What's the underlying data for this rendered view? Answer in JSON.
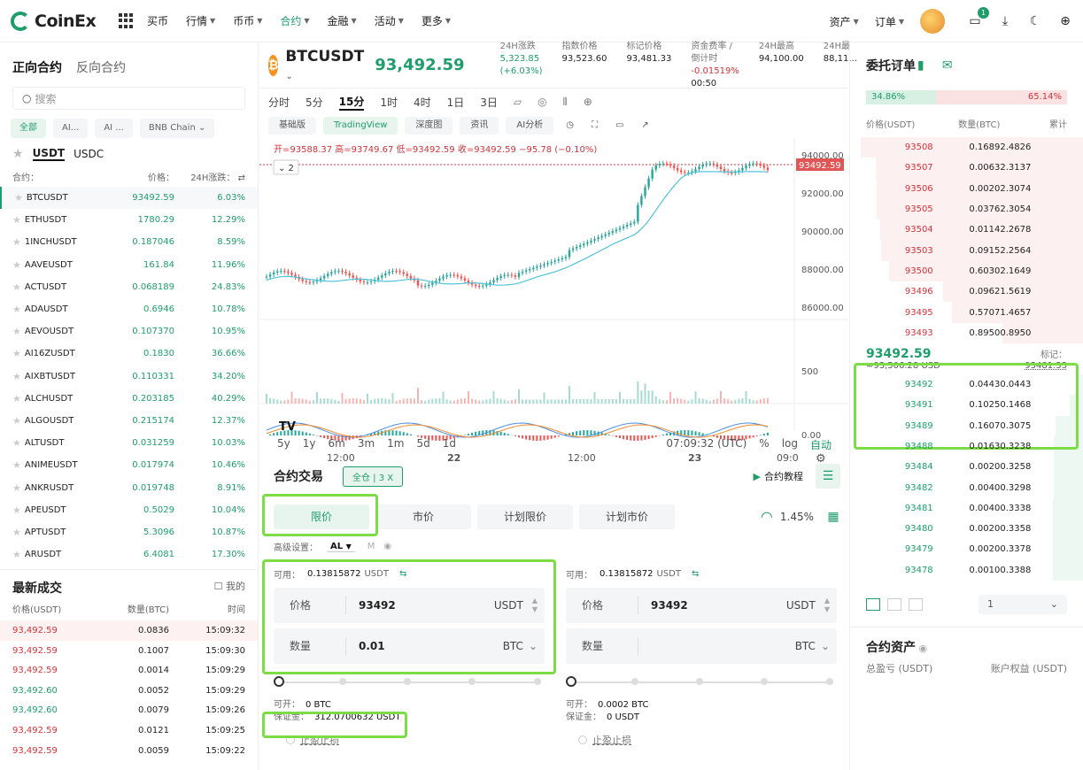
{
  "nav": {
    "brand": "CoinEx",
    "items": [
      "买币",
      "行情",
      "币币",
      "合约",
      "金融",
      "活动",
      "更多"
    ],
    "active": 3,
    "right": [
      "资产",
      "订单"
    ],
    "notif_count": "1"
  },
  "left": {
    "tabs": [
      "正向合约",
      "反向合约"
    ],
    "search_placeholder": "搜索",
    "filters": [
      "全部",
      "AI...",
      "AI ...",
      "BNB Chain"
    ],
    "quotes": [
      "USDT",
      "USDC"
    ],
    "head": {
      "c": "合约：",
      "p": "价格：",
      "ch": "24H涨跌："
    },
    "markets": [
      [
        "BTCUSDT",
        "93492.59",
        "6.03%"
      ],
      [
        "ETHUSDT",
        "1780.29",
        "12.29%"
      ],
      [
        "1INCHUSDT",
        "0.187046",
        "8.59%"
      ],
      [
        "AAVEUSDT",
        "161.84",
        "11.96%"
      ],
      [
        "ACTUSDT",
        "0.068189",
        "24.83%"
      ],
      [
        "ADAUSDT",
        "0.6946",
        "10.78%"
      ],
      [
        "AEVOUSDT",
        "0.107370",
        "10.95%"
      ],
      [
        "AI16ZUSDT",
        "0.1830",
        "36.66%"
      ],
      [
        "AIXBTUSDT",
        "0.110331",
        "34.20%"
      ],
      [
        "ALCHUSDT",
        "0.203185",
        "40.29%"
      ],
      [
        "ALGOUSDT",
        "0.215174",
        "12.37%"
      ],
      [
        "ALTUSDT",
        "0.031259",
        "10.03%"
      ],
      [
        "ANIMEUSDT",
        "0.017974",
        "10.46%"
      ],
      [
        "ANKRUSDT",
        "0.019748",
        "8.91%"
      ],
      [
        "APEUSDT",
        "0.5029",
        "10.04%"
      ],
      [
        "APTUSDT",
        "5.3096",
        "10.87%"
      ],
      [
        "ARUSDT",
        "6.4081",
        "17.30%"
      ]
    ],
    "trades_title": "最新成交",
    "trades_mine": "我的",
    "trades_cols": [
      "价格(USDT)",
      "数量(BTC)",
      "时间"
    ],
    "trades": [
      [
        "93,492.59",
        "0.0836",
        "15:09:32",
        "dn"
      ],
      [
        "93,492.59",
        "0.1007",
        "15:09:30",
        "dn"
      ],
      [
        "93,492.59",
        "0.0014",
        "15:09:29",
        "dn"
      ],
      [
        "93,492.60",
        "0.0052",
        "15:09:29",
        "up"
      ],
      [
        "93,492.60",
        "0.0079",
        "15:09:26",
        "up"
      ],
      [
        "93,492.59",
        "0.0121",
        "15:09:25",
        "dn"
      ],
      [
        "93,492.59",
        "0.0059",
        "15:09:22",
        "dn"
      ]
    ]
  },
  "ticker": {
    "symbol": "BTCUSDT",
    "price": "93,492.59",
    "stats": [
      [
        "24H涨跌",
        "5,323.85 (+6.03%)",
        "up"
      ],
      [
        "指数价格",
        "93,523.60",
        ""
      ],
      [
        "标记价格",
        "93,481.33",
        ""
      ],
      [
        "资金费率 / 倒计时",
        "-0.01519%  00:50",
        "fund"
      ],
      [
        "24H最高",
        "94,100.00",
        ""
      ],
      [
        "24H最",
        "88,11...",
        ""
      ]
    ]
  },
  "chart": {
    "timeframes": [
      "分时",
      "5分",
      "15分",
      "1时",
      "4时",
      "1日",
      "3日"
    ],
    "active_tf": 2,
    "types": [
      "基础版",
      "TradingView",
      "深度图",
      "资讯",
      "AI分析"
    ],
    "active_type": 1,
    "ohlc": "开=93588.37 高=93749.67 低=93492.59 收=93492.59 −95.78 (−0.10%)",
    "indicator_count": "2",
    "price_ticks": [
      "94000.00",
      "92000.00",
      "90000.00",
      "88000.00",
      "86000.00"
    ],
    "last_price": "93492.59",
    "vol_ticks": [
      "500",
      "0.00"
    ],
    "time_ticks": [
      "12:00",
      "22",
      "12:00",
      "23",
      "09:0"
    ],
    "ranges": [
      "5y",
      "1y",
      "6m",
      "3m",
      "1m",
      "5d",
      "1d"
    ],
    "clock": "07:09:32 (UTC)",
    "opts": [
      "%",
      "log",
      "自动"
    ]
  },
  "trade": {
    "title": "合约交易",
    "margin_mode": "全仓 | 3 X",
    "tutorial": "合约教程",
    "order_types": [
      "限价",
      "市价",
      "计划限价",
      "计划市价"
    ],
    "gauge": "1.45%",
    "advanced": "高级设置：",
    "adv_val": "AL",
    "adv_m": "M",
    "buy": {
      "avail_label": "可用：",
      "avail": "0.13815872",
      "avail_unit": "USDT",
      "price_label": "价格",
      "price": "93492",
      "price_unit": "USDT",
      "qty_label": "数量",
      "qty": "0.01",
      "qty_unit": "BTC",
      "open_label": "可开：",
      "open": "0 BTC",
      "margin_label": "保证金：",
      "margin": "312.0700632 USDT",
      "tpsl": "止盈止损"
    },
    "sell": {
      "avail_label": "可用：",
      "avail": "0.13815872",
      "avail_unit": "USDT",
      "price_label": "价格",
      "price": "93492",
      "price_unit": "USDT",
      "qty_label": "数量",
      "qty": "",
      "qty_unit": "BTC",
      "open_label": "可开：",
      "open": "0.0002 BTC",
      "margin_label": "保证金：",
      "margin": "0 USDT",
      "tpsl": "止盈止损"
    }
  },
  "book": {
    "title": "委托订单",
    "buy_ratio": "34.86%",
    "sell_ratio": "65.14%",
    "cols": [
      "价格(USDT)",
      "数量(BTC)",
      "累计"
    ],
    "asks": [
      [
        "93508",
        "0.1689",
        "2.4826"
      ],
      [
        "93507",
        "0.0063",
        "2.3137"
      ],
      [
        "93506",
        "0.0020",
        "2.3074"
      ],
      [
        "93505",
        "0.0376",
        "2.3054"
      ],
      [
        "93504",
        "0.0114",
        "2.2678"
      ],
      [
        "93503",
        "0.0915",
        "2.2564"
      ],
      [
        "93500",
        "0.6030",
        "2.1649"
      ],
      [
        "93496",
        "0.0962",
        "1.5619"
      ],
      [
        "93495",
        "0.5707",
        "1.4657"
      ],
      [
        "93493",
        "0.8950",
        "0.8950"
      ]
    ],
    "mid": "93492.59",
    "mid_usd": "≈93,506.28  USD",
    "mark_label": "标记：",
    "mark": "93481.33",
    "bids": [
      [
        "93492",
        "0.0443",
        "0.0443"
      ],
      [
        "93491",
        "0.1025",
        "0.1468"
      ],
      [
        "93489",
        "0.1607",
        "0.3075"
      ],
      [
        "93488",
        "0.0163",
        "0.3238"
      ],
      [
        "93484",
        "0.0020",
        "0.3258"
      ],
      [
        "93482",
        "0.0040",
        "0.3298"
      ],
      [
        "93481",
        "0.0040",
        "0.3338"
      ],
      [
        "93480",
        "0.0020",
        "0.3358"
      ],
      [
        "93479",
        "0.0020",
        "0.3378"
      ],
      [
        "93478",
        "0.0010",
        "0.3388"
      ]
    ],
    "depth_sel": "1",
    "assets_title": "合约资产",
    "pnl": "总盈亏 (USDT)",
    "equity": "账户权益 (USDT)"
  }
}
